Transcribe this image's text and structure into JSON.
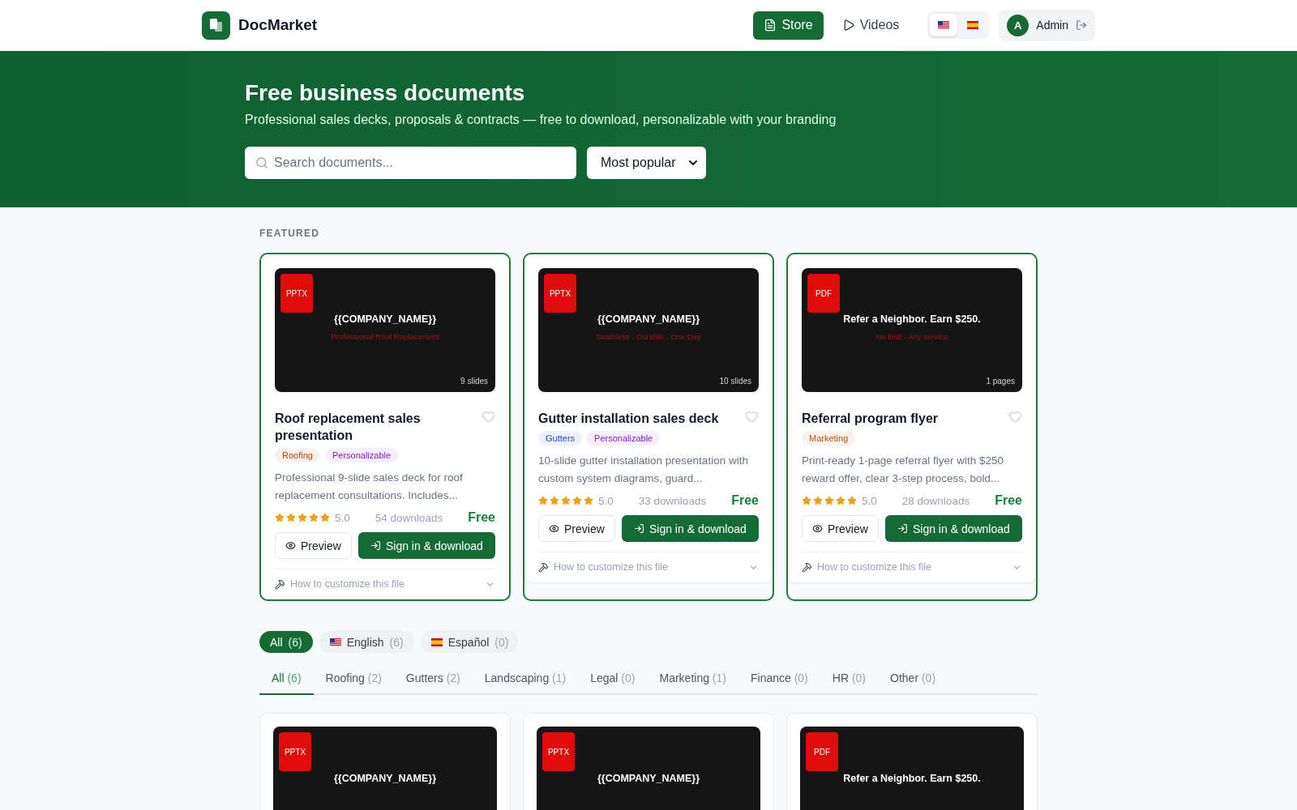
{
  "header": {
    "brand": "DocMarket",
    "nav": [
      {
        "kind": "store",
        "label": "Store",
        "selected": true
      },
      {
        "kind": "videos",
        "label": "Videos",
        "selected": false
      }
    ],
    "languages": [
      {
        "kind": "us",
        "selected": true
      },
      {
        "kind": "es",
        "selected": false
      }
    ],
    "user": {
      "initial": "A",
      "name": "Admin"
    }
  },
  "hero": {
    "title": "Free business documents",
    "subtitle": "Professional sales decks, proposals & contracts — free to download, personalizable with your branding",
    "search": {
      "placeholder": "Search documents..."
    },
    "sort": {
      "value": "Most popular"
    }
  },
  "featured": {
    "label": "FEATURED",
    "cards": [
      {
        "format": "PPTX",
        "preview_title": "{{COMPANY_NAME}}",
        "preview_subtitle": "Professional Roof Replacement",
        "length": "9 slides",
        "title": "Roof replacement sales presentation",
        "tags": [
          {
            "label": "Roofing",
            "color": "#c2410c"
          },
          {
            "label": "Personalizable",
            "color": "#7e22ce"
          }
        ],
        "description": "Professional 9-slide sales deck for roof replacement consultations. Includes...",
        "stars": 5,
        "rating": "5.0",
        "downloads": "54 downloads",
        "price": "Free",
        "preview_button": "Preview",
        "download_button": "Sign in & download",
        "customize": "How to customize this file"
      },
      {
        "format": "PPTX",
        "preview_title": "{{COMPANY_NAME}}",
        "preview_subtitle": "Seamless · Durable · One Day",
        "length": "10 slides",
        "title": "Gutter installation sales deck",
        "tags": [
          {
            "label": "Gutters",
            "color": "#1d4ed8"
          },
          {
            "label": "Personalizable",
            "color": "#7e22ce"
          }
        ],
        "description": "10-slide gutter installation presentation with custom system diagrams, guard...",
        "stars": 5,
        "rating": "5.0",
        "downloads": "33 downloads",
        "price": "Free",
        "preview_button": "Preview",
        "download_button": "Sign in & download",
        "customize": "How to customize this file"
      },
      {
        "format": "PDF",
        "preview_title": "Refer a Neighbor. Earn $250.",
        "preview_subtitle": "No limit · Any service",
        "length": "1 pages",
        "title": "Referral program flyer",
        "tags": [
          {
            "label": "Marketing",
            "color": "#b45309"
          }
        ],
        "description": "Print-ready 1-page referral flyer with $250 reward offer, clear 3-step process, bold...",
        "stars": 5,
        "rating": "5.0",
        "downloads": "28 downloads",
        "price": "Free",
        "preview_button": "Preview",
        "download_button": "Sign in & download",
        "customize": "How to customize this file"
      }
    ]
  },
  "language_filters": [
    {
      "kind": "all",
      "label": "All",
      "count": "(6)",
      "selected": true
    },
    {
      "kind": "us",
      "label": "English",
      "count": "(6)",
      "selected": false
    },
    {
      "kind": "es",
      "label": "Español",
      "count": "(0)",
      "selected": false
    }
  ],
  "category_tabs": [
    {
      "label": "All",
      "count": "(6)",
      "selected": true
    },
    {
      "label": "Roofing",
      "count": "(2)",
      "selected": false
    },
    {
      "label": "Gutters",
      "count": "(2)",
      "selected": false
    },
    {
      "label": "Landscaping",
      "count": "(1)",
      "selected": false
    },
    {
      "label": "Legal",
      "count": "(0)",
      "selected": false
    },
    {
      "label": "Marketing",
      "count": "(1)",
      "selected": false
    },
    {
      "label": "Finance",
      "count": "(0)",
      "selected": false
    },
    {
      "label": "HR",
      "count": "(0)",
      "selected": false
    },
    {
      "label": "Other",
      "count": "(0)",
      "selected": false
    }
  ],
  "grid": [
    {
      "format": "PPTX",
      "preview_title": "{{COMPANY_NAME}}"
    },
    {
      "format": "PPTX",
      "preview_title": "{{COMPANY_NAME}}"
    },
    {
      "format": "PDF",
      "preview_title": "Refer a Neighbor. Earn $250."
    }
  ]
}
